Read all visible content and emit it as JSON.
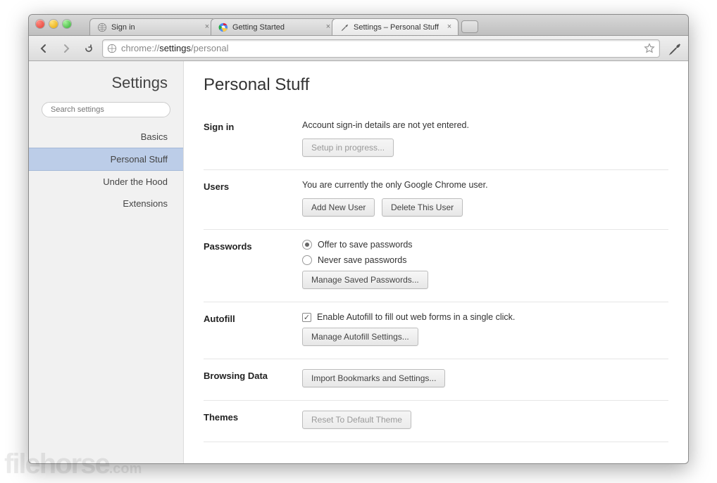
{
  "tabs": [
    {
      "label": "Sign in",
      "icon": "globe"
    },
    {
      "label": "Getting Started",
      "icon": "chrome"
    },
    {
      "label": "Settings – Personal Stuff",
      "icon": "wrench",
      "active": true
    }
  ],
  "toolbar": {
    "url_scheme": "chrome://",
    "url_host": "settings",
    "url_path": "/personal"
  },
  "sidebar": {
    "title": "Settings",
    "search_placeholder": "Search settings",
    "items": [
      {
        "label": "Basics"
      },
      {
        "label": "Personal Stuff",
        "selected": true
      },
      {
        "label": "Under the Hood"
      },
      {
        "label": "Extensions"
      }
    ]
  },
  "page": {
    "title": "Personal Stuff",
    "signin": {
      "heading": "Sign in",
      "desc": "Account sign-in details are not yet entered.",
      "button": "Setup in progress..."
    },
    "users": {
      "heading": "Users",
      "desc": "You are currently the only Google Chrome user.",
      "add_btn": "Add New User",
      "delete_btn": "Delete This User"
    },
    "passwords": {
      "heading": "Passwords",
      "opt_offer": "Offer to save passwords",
      "opt_never": "Never save passwords",
      "manage_btn": "Manage Saved Passwords..."
    },
    "autofill": {
      "heading": "Autofill",
      "checkbox_label": "Enable Autofill to fill out web forms in a single click.",
      "manage_btn": "Manage Autofill Settings..."
    },
    "browsing": {
      "heading": "Browsing Data",
      "import_btn": "Import Bookmarks and Settings..."
    },
    "themes": {
      "heading": "Themes",
      "reset_btn": "Reset To Default Theme"
    }
  },
  "watermark": {
    "brand": "filehorse",
    "suffix": ".com"
  }
}
